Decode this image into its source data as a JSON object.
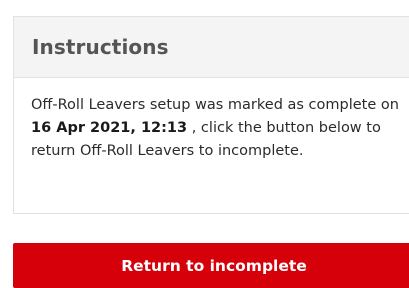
{
  "instructions": {
    "title": "Instructions",
    "text_before": "Off-Roll Leavers setup was marked as complete on ",
    "completed_datetime": "16 Apr 2021, 12:13",
    "text_after": " , click the button below to return Off-Roll Leavers to incomplete."
  },
  "actions": {
    "return_label": "Return to incomplete"
  },
  "colors": {
    "button_background": "#d6000b",
    "header_background": "#f4f4f4"
  }
}
